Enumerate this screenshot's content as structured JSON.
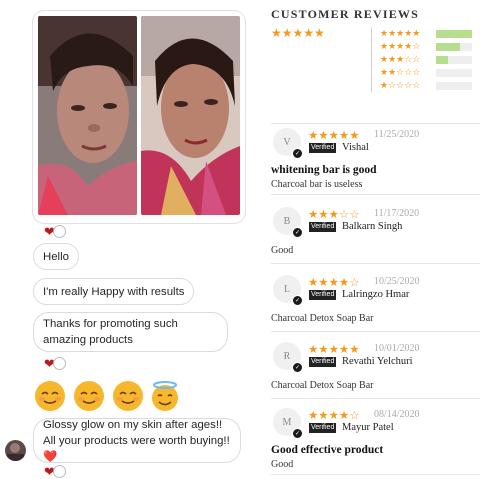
{
  "chat": {
    "messages": [
      {
        "text": "Hello"
      },
      {
        "text": "I'm really Happy with results"
      },
      {
        "text": "Thanks for promoting such amazing products"
      },
      {
        "text": "Glossy glow on my skin after ages!! All your products were worth buying!!❤️"
      }
    ],
    "reaction_heart": "❤",
    "emojis": [
      "relieved-emoji",
      "relieved-emoji",
      "relieved-emoji",
      "halo-emoji"
    ]
  },
  "reviews_panel": {
    "title": "CUSTOMER REVIEWS",
    "overall_rating": 4.5,
    "overall_stars": "★★★★★",
    "histogram": [
      {
        "stars": "★★★★★",
        "fraction": 1.0
      },
      {
        "stars": "★★★★☆",
        "fraction": 0.67
      },
      {
        "stars": "★★★☆☆",
        "fraction": 0.33
      },
      {
        "stars": "★★☆☆☆",
        "fraction": 0.0
      },
      {
        "stars": "★☆☆☆☆",
        "fraction": 0.0
      }
    ],
    "verified_label": "Verified",
    "reviews": [
      {
        "initial": "V",
        "stars": "★★★★★",
        "date": "11/25/2020",
        "name": "Vishal",
        "title": "whitening bar is good",
        "body": "Charcoal bar is useless"
      },
      {
        "initial": "B",
        "stars": "★★★☆☆",
        "date": "11/17/2020",
        "name": "Balkarn Singh",
        "title": "",
        "body": "Good"
      },
      {
        "initial": "L",
        "stars": "★★★★☆",
        "date": "10/25/2020",
        "name": "Lalringzo Hmar",
        "title": "",
        "body": "Charcoal Detox Soap Bar"
      },
      {
        "initial": "R",
        "stars": "★★★★★",
        "date": "10/01/2020",
        "name": "Revathi Yelchuri",
        "title": "",
        "body": "Charcoal Detox Soap Bar"
      },
      {
        "initial": "M",
        "stars": "★★★★☆",
        "date": "08/14/2020",
        "name": "Mayur Patel",
        "title": "Good effective product",
        "body": "Good"
      }
    ]
  },
  "colors": {
    "star": "#f39a1c",
    "bar_fill": "#b7dd8e",
    "heart": "#c0171f"
  }
}
